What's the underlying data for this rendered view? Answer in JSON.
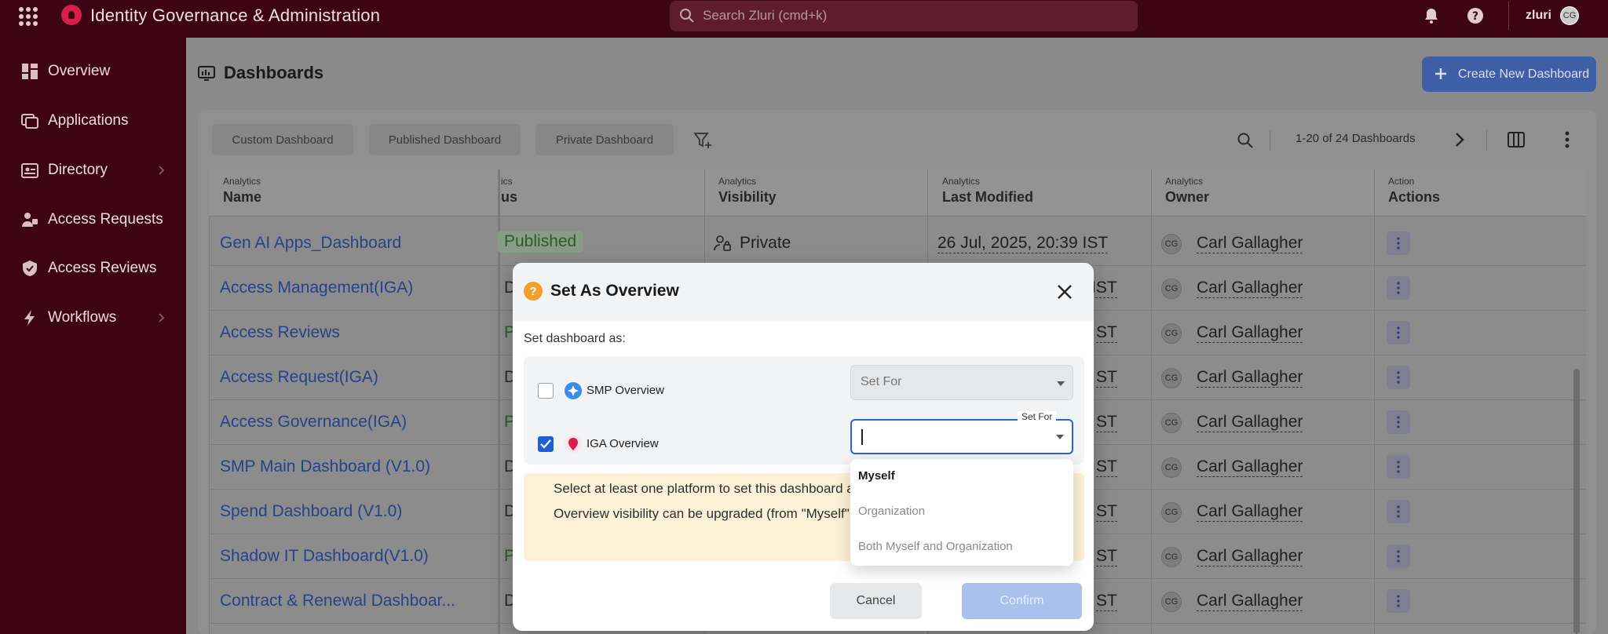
{
  "topbar": {
    "app_title": "Identity Governance & Administration",
    "search_placeholder": "Search Zluri (cmd+k)",
    "brand": "zluri",
    "avatar_initials": "CG"
  },
  "sidebar": {
    "items": [
      {
        "label": "Overview"
      },
      {
        "label": "Applications"
      },
      {
        "label": "Directory"
      },
      {
        "label": "Access Requests"
      },
      {
        "label": "Access Reviews"
      },
      {
        "label": "Workflows"
      }
    ]
  },
  "page": {
    "title": "Dashboards",
    "create_button": "Create New Dashboard"
  },
  "filters": {
    "tabs": [
      "Custom Dashboard",
      "Published Dashboard",
      "Private Dashboard"
    ],
    "count": "1-20 of 24 Dashboards"
  },
  "table": {
    "headers": [
      {
        "group": "Analytics",
        "label": "Name"
      },
      {
        "group": "ics",
        "label": "us"
      },
      {
        "group": "Analytics",
        "label": "Visibility"
      },
      {
        "group": "Analytics",
        "label": "Last Modified"
      },
      {
        "group": "Analytics",
        "label": "Owner"
      },
      {
        "group": "Action",
        "label": "Actions"
      }
    ],
    "rows": [
      {
        "name": "Gen AI Apps_Dashboard",
        "status": "Published",
        "visibility": "Private",
        "modified": "26 Jul, 2025, 20:39 IST",
        "owner_initials": "CG",
        "owner": "Carl Gallagher"
      },
      {
        "name": "Access Management(IGA)",
        "status": "D",
        "modified_tail": "IST",
        "owner_initials": "CG",
        "owner": "Carl Gallagher"
      },
      {
        "name": "Access Reviews",
        "status": "P",
        "modified_tail": "ST",
        "owner_initials": "CG",
        "owner": "Carl Gallagher"
      },
      {
        "name": "Access Request(IGA)",
        "status": "D",
        "modified_tail": "ST",
        "owner_initials": "CG",
        "owner": "Carl Gallagher"
      },
      {
        "name": "Access Governance(IGA)",
        "status": "P",
        "modified_tail": "ST",
        "owner_initials": "CG",
        "owner": "Carl Gallagher"
      },
      {
        "name": "SMP Main Dashboard (V1.0)",
        "status": "D",
        "modified_tail": "ST",
        "owner_initials": "CG",
        "owner": "Carl Gallagher"
      },
      {
        "name": "Spend Dashboard (V1.0)",
        "status": "D",
        "modified_tail": "ST",
        "owner_initials": "CG",
        "owner": "Carl Gallagher"
      },
      {
        "name": "Shadow IT Dashboard(V1.0)",
        "status": "P",
        "modified_tail": "ST",
        "owner_initials": "CG",
        "owner": "Carl Gallagher"
      },
      {
        "name": "Contract & Renewal Dashboar...",
        "status": "D",
        "modified_tail": "ST",
        "owner_initials": "CG",
        "owner": "Carl Gallagher"
      }
    ]
  },
  "modal": {
    "title": "Set As Overview",
    "subtitle": "Set dashboard as:",
    "option1": {
      "label": "SMP Overview",
      "checked": false,
      "select_value": "Set For"
    },
    "option2": {
      "label": "IGA Overview",
      "checked": true,
      "select_label": "Set For"
    },
    "info": [
      "Select at least one platform to set this dashboard as overview and choose whether it's for yourself or the entire organization.",
      "Overview visibility can be upgraded (from \"Myself\" to \"Organization\") but not downgraded and can only be changed by users."
    ],
    "cancel": "Cancel",
    "confirm": "Confirm",
    "dropdown": [
      "Myself",
      "Organization",
      "Both Myself and Organization"
    ]
  },
  "colors": {
    "topbar": "#3d0513",
    "accent": "#2962d9",
    "link": "#25428a"
  }
}
